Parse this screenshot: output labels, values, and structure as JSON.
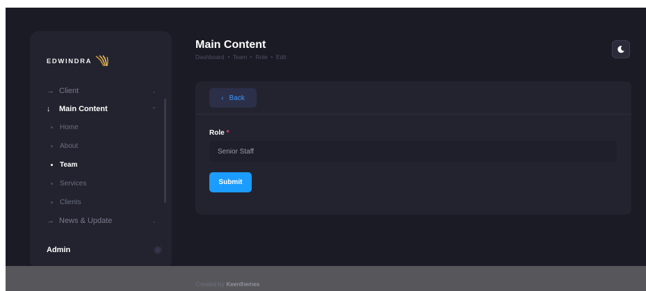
{
  "logo": {
    "text": "EDWINDRA"
  },
  "sidebar": {
    "menu": [
      {
        "label": "Client",
        "arrow": "→",
        "chevron": "⌄"
      },
      {
        "label": "Main Content",
        "arrow": "↓",
        "chevron": "⌃"
      },
      {
        "label": "News & Update",
        "arrow": "→",
        "chevron": "⌄"
      }
    ],
    "sub_items": [
      "Home",
      "About",
      "Team",
      "Services",
      "Clients"
    ],
    "admin_label": "Admin"
  },
  "header": {
    "title": "Main Content",
    "breadcrumb": [
      "Dashboard",
      "Team",
      "Role",
      "Edit"
    ]
  },
  "card": {
    "back_label": "Back",
    "back_chevron": "‹",
    "role_label": "Role",
    "required_mark": "*",
    "role_value": "Senior Staff",
    "submit_label": "Submit"
  },
  "footer": {
    "prefix": "Created by",
    "brand": "Keenthemes"
  },
  "colors": {
    "accent": "#1b9cff",
    "background": "#1b1b25",
    "card": "#23232f",
    "required": "#f1416c"
  }
}
